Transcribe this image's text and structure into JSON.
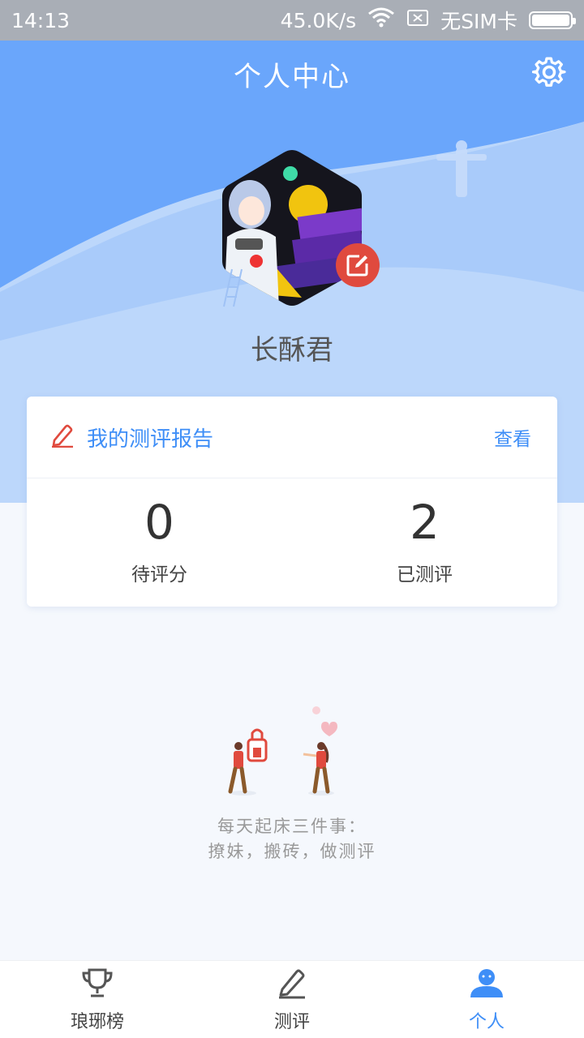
{
  "status_bar": {
    "time": "14:13",
    "speed": "45.0K/s",
    "sim": "无SIM卡"
  },
  "header": {
    "title": "个人中心",
    "settings_icon": "gear-icon"
  },
  "profile": {
    "username": "长酥君"
  },
  "report_card": {
    "title": "我的测评报告",
    "view_link": "查看",
    "stats": [
      {
        "value": "0",
        "label": "待评分"
      },
      {
        "value": "2",
        "label": "已测评"
      }
    ]
  },
  "motto": {
    "line1": "每天起床三件事：",
    "line2": "撩妹，搬砖，做测评"
  },
  "tabs": [
    {
      "label": "琅琊榜",
      "icon": "trophy-icon"
    },
    {
      "label": "测评",
      "icon": "pencil-icon"
    },
    {
      "label": "个人",
      "icon": "person-icon"
    }
  ],
  "colors": {
    "accent": "#3e8ef7",
    "header_blue": "#6aa6fb",
    "edit_red": "#e04a3e"
  }
}
